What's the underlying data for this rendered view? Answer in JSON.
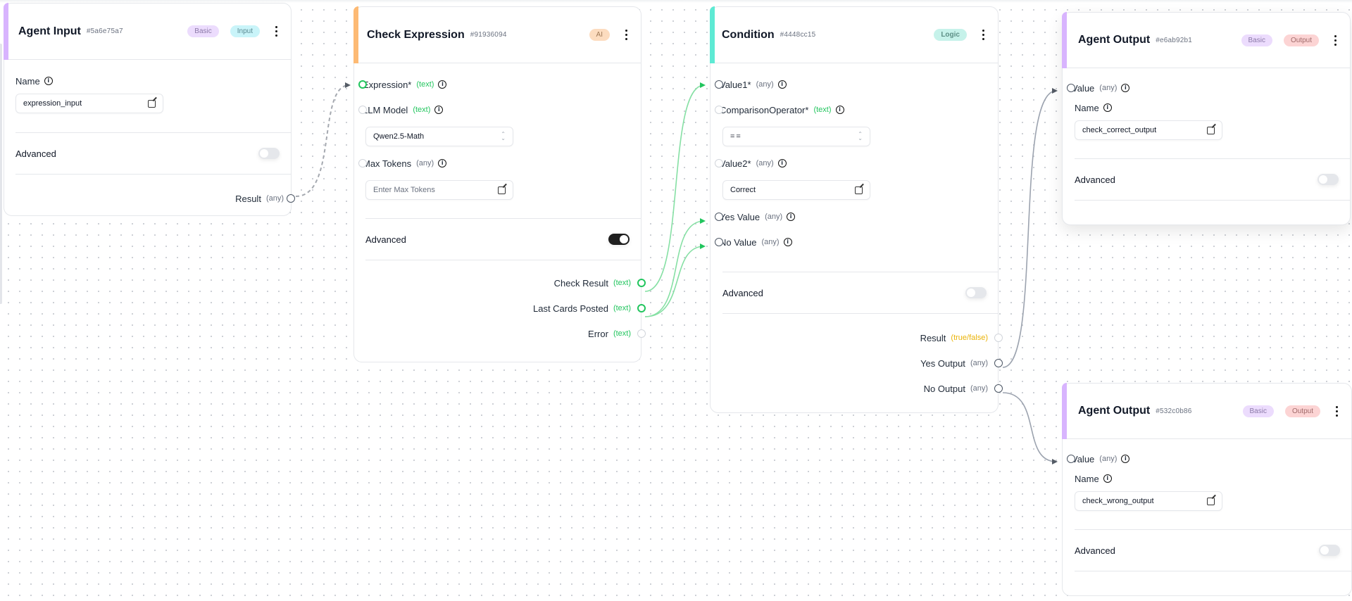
{
  "canvas": {
    "grid": "dots",
    "colors": {
      "accent_basic": "#d8b4fe",
      "accent_ai": "#fdba74",
      "accent_logic": "#5eead4",
      "type_text": "#22c55e",
      "type_bool": "#eab308",
      "edge_active": "#86e0a4",
      "edge_default": "#9ca3af"
    }
  },
  "nodes": {
    "agent_input": {
      "title": "Agent Input",
      "id": "#5a6e75a7",
      "badges": [
        "Basic",
        "Input"
      ],
      "menu_icon": "kebab-icon",
      "name_label": "Name",
      "name_value": "expression_input",
      "advanced_label": "Advanced",
      "advanced_on": false,
      "outputs": [
        {
          "label": "Result",
          "type": "(any)"
        }
      ]
    },
    "check_expression": {
      "title": "Check Expression",
      "id": "#91936094",
      "badges": [
        "AI"
      ],
      "inputs": [
        {
          "label": "Expression*",
          "type": "(text)"
        },
        {
          "label": "LLM Model",
          "type": "(text)"
        },
        {
          "label": "Max Tokens",
          "type": "(any)"
        }
      ],
      "llm_model_value": "Qwen2.5-Math",
      "max_tokens_placeholder": "Enter Max Tokens",
      "advanced_label": "Advanced",
      "advanced_on": true,
      "outputs": [
        {
          "label": "Check Result",
          "type": "(text)"
        },
        {
          "label": "Last Cards Posted",
          "type": "(text)"
        },
        {
          "label": "Error",
          "type": "(text)"
        }
      ]
    },
    "condition": {
      "title": "Condition",
      "id": "#4448cc15",
      "badges": [
        "Logic"
      ],
      "inputs": [
        {
          "label": "Value1*",
          "type": "(any)"
        },
        {
          "label": "ComparisonOperator*",
          "type": "(text)"
        },
        {
          "label": "Value2*",
          "type": "(any)"
        },
        {
          "label": "Yes Value",
          "type": "(any)"
        },
        {
          "label": "No Value",
          "type": "(any)"
        }
      ],
      "operator_value": "==",
      "value2_value": "Correct",
      "advanced_label": "Advanced",
      "advanced_on": false,
      "outputs": [
        {
          "label": "Result",
          "type": "(true/false)"
        },
        {
          "label": "Yes Output",
          "type": "(any)"
        },
        {
          "label": "No Output",
          "type": "(any)"
        }
      ]
    },
    "agent_output_1": {
      "title": "Agent Output",
      "id": "#e6ab92b1",
      "badges": [
        "Basic",
        "Output"
      ],
      "inputs": [
        {
          "label": "Value",
          "type": "(any)"
        }
      ],
      "name_label": "Name",
      "name_value": "check_correct_output",
      "advanced_label": "Advanced",
      "advanced_on": false
    },
    "agent_output_2": {
      "title": "Agent Output",
      "id": "#532c0b86",
      "badges": [
        "Basic",
        "Output"
      ],
      "inputs": [
        {
          "label": "Value",
          "type": "(any)"
        }
      ],
      "name_label": "Name",
      "name_value": "check_wrong_output",
      "advanced_label": "Advanced",
      "advanced_on": false
    }
  },
  "edges": [
    {
      "from": "Agent Input.Result",
      "to": "Check Expression.Expression*",
      "style": "dashed"
    },
    {
      "from": "Check Expression.Check Result",
      "to": "Condition.Value1*",
      "style": "active"
    },
    {
      "from": "Check Expression.Last Cards Posted",
      "to": "Condition.Yes Value",
      "style": "active"
    },
    {
      "from": "Check Expression.Last Cards Posted",
      "to": "Condition.No Value",
      "style": "active"
    },
    {
      "from": "Condition.Yes Output",
      "to": "Agent Output #e6ab92b1.Value",
      "style": "default"
    },
    {
      "from": "Condition.No Output",
      "to": "Agent Output #532c0b86.Value",
      "style": "default"
    }
  ]
}
